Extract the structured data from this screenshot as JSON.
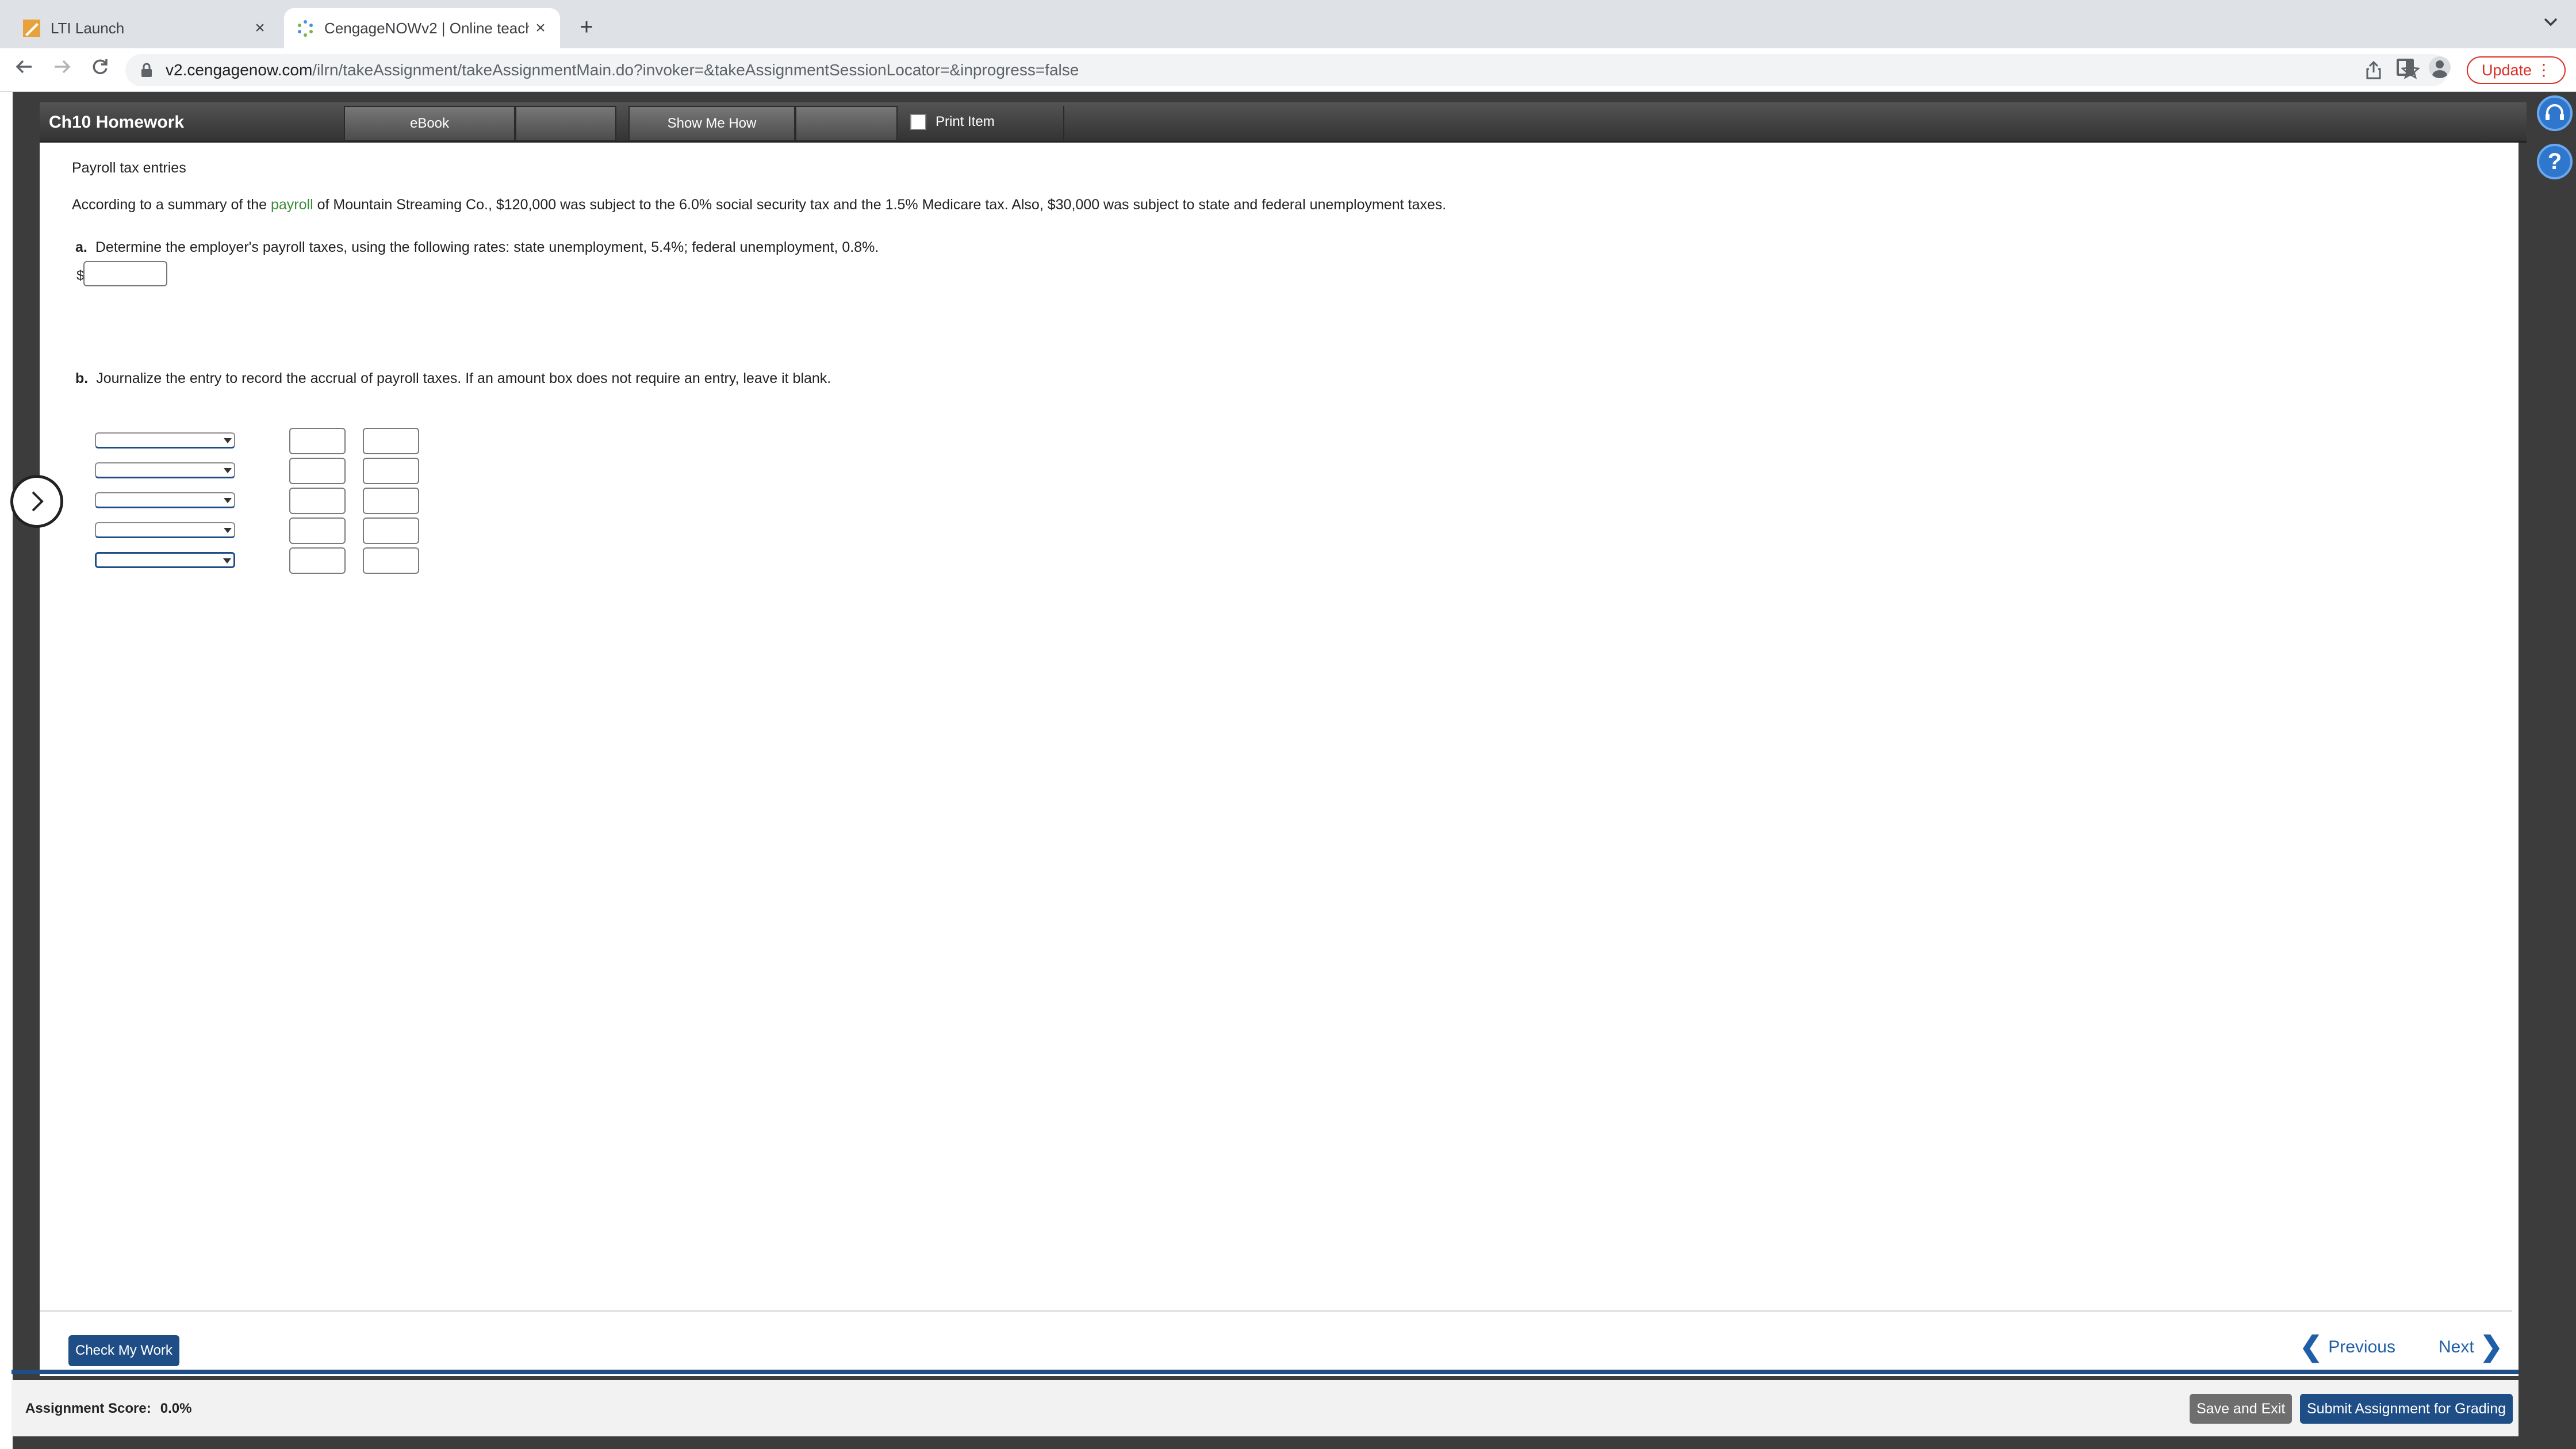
{
  "browser": {
    "tabs": [
      {
        "title": "LTI Launch",
        "active": false
      },
      {
        "title": "CengageNOWv2 | Online teach",
        "active": true
      }
    ],
    "url_host": "v2.cengagenow.com",
    "url_path": "/ilrn/takeAssignment/takeAssignmentMain.do?invoker=&takeAssignmentSessionLocator=&inprogress=false",
    "update_label": "Update",
    "close_glyph": "×",
    "new_tab_glyph": "+",
    "kebab_glyph": "⋮"
  },
  "assignment": {
    "title": "Ch10 Homework",
    "header_tabs": {
      "ebook": "eBook",
      "show_me_how": "Show Me How",
      "print_item": "Print Item"
    }
  },
  "problem": {
    "title": "Payroll tax entries",
    "text_before_link": "According to a summary of the ",
    "link_text": "payroll",
    "text_after_link": " of Mountain Streaming Co., $120,000 was subject to the 6.0% social security tax and the 1.5% Medicare tax. Also, $30,000 was subject to state and federal unemployment taxes.",
    "part_a": {
      "label": "a.",
      "text": "Determine the employer's payroll taxes, using the following rates: state unemployment, 5.4%; federal unemployment, 0.8%.",
      "currency": "$",
      "value": ""
    },
    "part_b": {
      "label": "b.",
      "text": "Journalize the entry to record the accrual of payroll taxes. If an amount box does not require an entry, leave it blank.",
      "rows": [
        {
          "account": "",
          "debit": "",
          "credit": ""
        },
        {
          "account": "",
          "debit": "",
          "credit": ""
        },
        {
          "account": "",
          "debit": "",
          "credit": ""
        },
        {
          "account": "",
          "debit": "",
          "credit": ""
        },
        {
          "account": "",
          "debit": "",
          "credit": ""
        }
      ]
    }
  },
  "footer": {
    "check_my_work": "Check My Work",
    "previous": "Previous",
    "next": "Next"
  },
  "score_bar": {
    "label": "Assignment Score:",
    "value": "0.0%",
    "save_and_exit": "Save and Exit",
    "submit": "Submit Assignment for Grading"
  },
  "colors": {
    "brand_blue": "#1f4e87",
    "link_green": "#3a8a3a",
    "update_red": "#d93025"
  },
  "icons": [
    "back-arrow-icon",
    "forward-arrow-icon",
    "reload-icon",
    "lock-icon",
    "share-icon",
    "star-icon",
    "side-panel-icon",
    "profile-icon",
    "headset-icon",
    "help-icon",
    "chevron-right-icon"
  ]
}
